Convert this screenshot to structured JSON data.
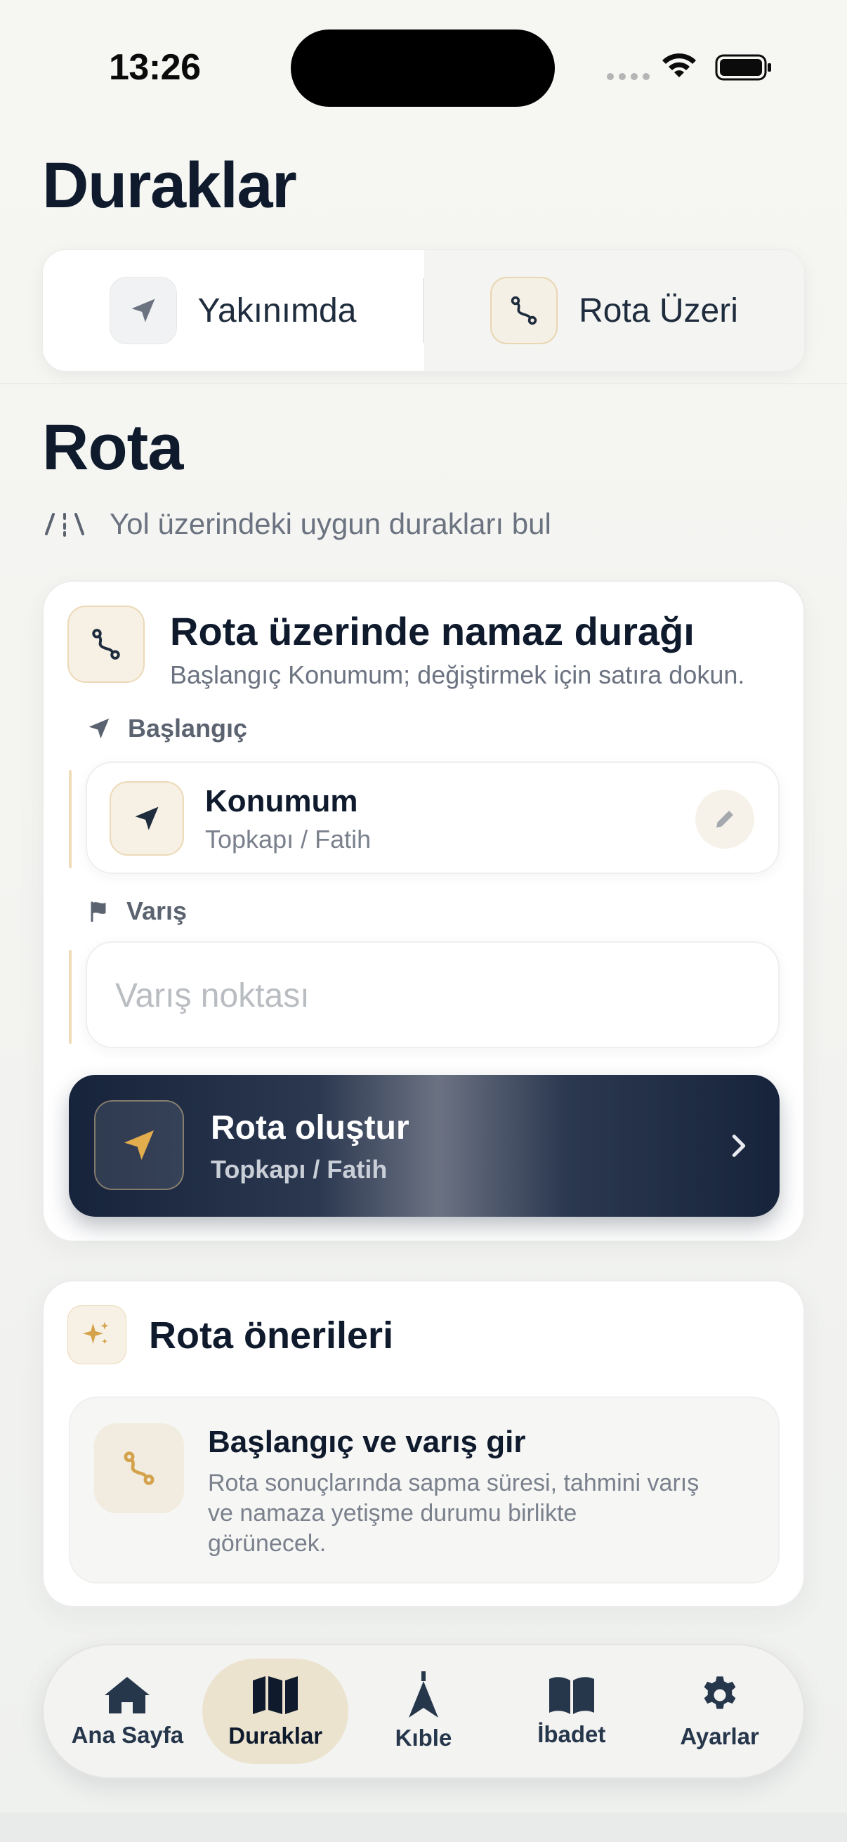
{
  "status_bar": {
    "time": "13:26"
  },
  "header": {
    "title": "Duraklar",
    "segments": [
      {
        "label": "Yakınımda",
        "icon": "location-arrow-icon",
        "active": false
      },
      {
        "label": "Rota Üzeri",
        "icon": "route-icon",
        "active": true
      }
    ]
  },
  "section": {
    "title": "Rota",
    "subtitle": "Yol üzerindeki uygun durakları bul",
    "subtitle_icon": "road-icon"
  },
  "route_card": {
    "title": "Rota üzerinde namaz durağı",
    "subtitle": "Başlangıç Konumum; değiştirmek için satıra dokun.",
    "origin": {
      "label": "Başlangıç",
      "title": "Konumum",
      "subtitle": "Topkapı / Fatih"
    },
    "destination": {
      "label": "Varış",
      "placeholder": "Varış noktası",
      "value": ""
    },
    "cta": {
      "title": "Rota oluştur",
      "subtitle": "Topkapı / Fatih"
    }
  },
  "suggestions_card": {
    "title": "Rota önerileri",
    "empty_title": "Başlangıç ve varış gir",
    "empty_text": "Rota sonuçlarında sapma süresi, tahmini varış ve namaza yetişme durumu birlikte görünecek."
  },
  "tabbar": {
    "items": [
      {
        "label": "Ana Sayfa",
        "icon": "home-icon",
        "active": false
      },
      {
        "label": "Duraklar",
        "icon": "map-icon",
        "active": true
      },
      {
        "label": "Kıble",
        "icon": "qibla-icon",
        "active": false
      },
      {
        "label": "İbadet",
        "icon": "book-icon",
        "active": false
      },
      {
        "label": "Ayarlar",
        "icon": "gear-icon",
        "active": false
      }
    ]
  },
  "colors": {
    "navy": "#0f1b2d",
    "gold": "#d4a24a",
    "accent_tint": "#ece3cf"
  }
}
